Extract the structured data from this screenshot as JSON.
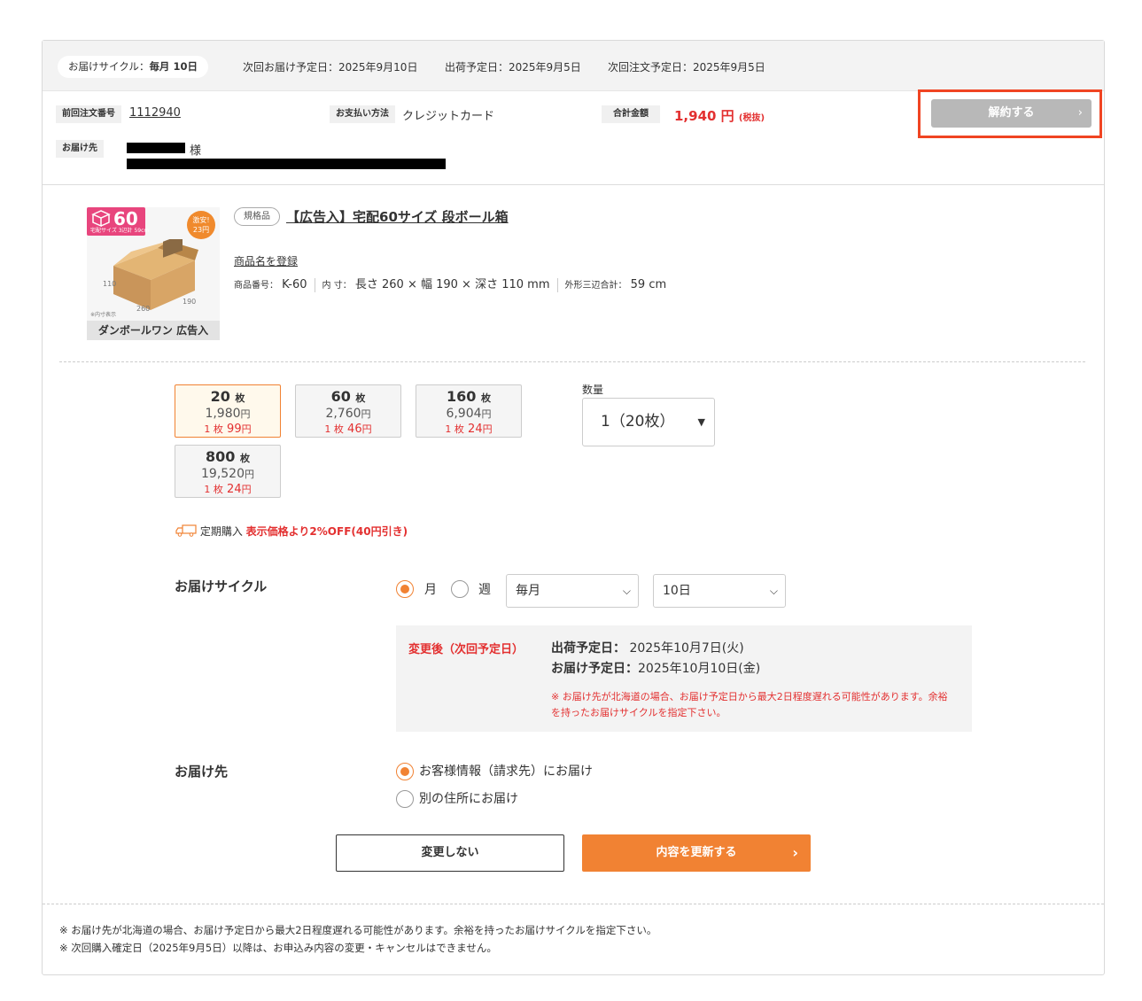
{
  "header": {
    "cycle_label": "お届けサイクル",
    "cycle_sep": "：",
    "cycle_value": "毎月 10日",
    "next_delivery": "次回お届け予定日：2025年9月10日",
    "ship_date": "出荷予定日：2025年9月5日",
    "next_order": "次回注文予定日：2025年9月5日"
  },
  "order": {
    "prev_order_label": "前回注文番号",
    "prev_order_no": "1112940",
    "payment_label": "お支払い方法",
    "payment_value": "クレジットカード",
    "total_label": "合計金額",
    "total_value": "1,940 円",
    "total_tax": "(税抜)",
    "cancel_button": "解約する",
    "dest_label": "お届け先",
    "dest_honorific": "様"
  },
  "product": {
    "image": {
      "size_badge": "60",
      "size_badge_sub": "宅配サイズ 3辺計 59cm",
      "cheap_badge": "激安!",
      "cheap_badge_price": "23円",
      "dim_110": "110",
      "dim_260": "260",
      "dim_190": "190",
      "inner_note": "※内寸表示",
      "brand": "ダンボールワン 広告入"
    },
    "kikaku_badge": "規格品",
    "title": "【広告入】宅配60サイズ 段ボール箱",
    "register_link": "商品名を登録",
    "code_label": "商品番号：",
    "code": "K-60",
    "inner_label": "内 寸：",
    "inner_value": "長さ 260 × 幅 190 × 深さ 110 mm",
    "outer_label": "外形三辺合計：",
    "outer_value": "59 cm"
  },
  "options": [
    {
      "qty": "20",
      "unit": "枚",
      "price": "1,980",
      "yen": "円",
      "per_label": "1 枚",
      "per": "99",
      "selected": true
    },
    {
      "qty": "60",
      "unit": "枚",
      "price": "2,760",
      "yen": "円",
      "per_label": "1 枚",
      "per": "46",
      "selected": false
    },
    {
      "qty": "160",
      "unit": "枚",
      "price": "6,904",
      "yen": "円",
      "per_label": "1 枚",
      "per": "24",
      "selected": false
    },
    {
      "qty": "800",
      "unit": "枚",
      "price": "19,520",
      "yen": "円",
      "per_label": "1 枚",
      "per": "24",
      "selected": false
    }
  ],
  "quantity": {
    "label": "数量",
    "value": "1（20枚）"
  },
  "teiki": {
    "label": "定期購入",
    "discount": "表示価格より2%OFF(40円引き)"
  },
  "cycle": {
    "label": "お届けサイクル",
    "radio_month": "月",
    "radio_week": "週",
    "select_period": "毎月",
    "select_day": "10日",
    "changed_title": "変更後（次回予定日）",
    "ship_label": "出荷予定日：",
    "ship_value": "2025年10月7日(火)",
    "deliver_label": "お届け予定日：",
    "deliver_value": "2025年10月10日(金)",
    "note": "※ お届け先が北海道の場合、お届け予定日から最大2日程度遅れる可能性があります。余裕を持ったお届けサイクルを指定下さい。"
  },
  "destination": {
    "label": "お届け先",
    "option_customer": "お客様情報（請求先）にお届け",
    "option_other": "別の住所にお届け"
  },
  "buttons": {
    "keep": "変更しない",
    "update": "内容を更新する"
  },
  "footer": {
    "note1": "※ お届け先が北海道の場合、お届け予定日から最大2日程度遅れる可能性があります。余裕を持ったお届けサイクルを指定下さい。",
    "note2": "※ 次回購入確定日（2025年9月5日）以降は、お申込み内容の変更・キャンセルはできません。"
  },
  "colors": {
    "accent": "#f18233",
    "price_red": "#e33030",
    "highlight_border": "#f04422"
  }
}
